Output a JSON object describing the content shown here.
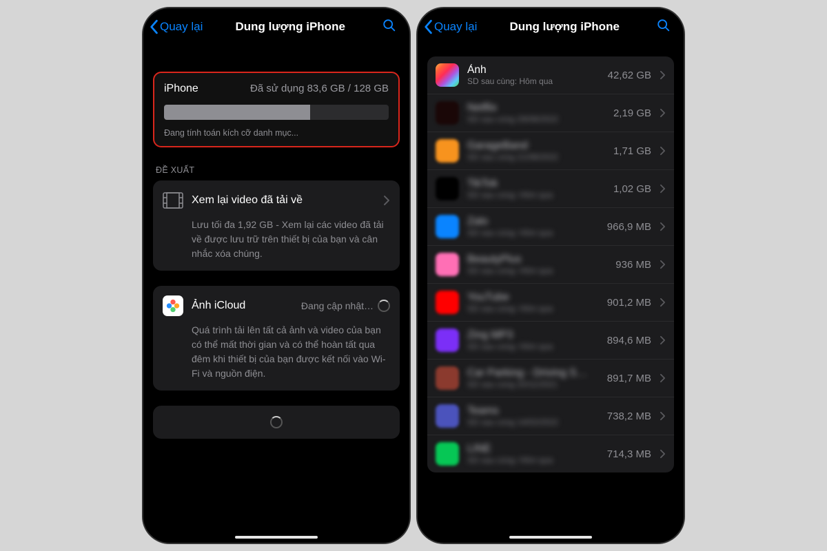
{
  "left": {
    "back_label": "Quay lại",
    "title": "Dung lượng iPhone",
    "storage": {
      "device": "iPhone",
      "used_text": "Đã sử dụng 83,6 GB / 128 GB",
      "bar_percent": 65,
      "calc_text": "Đang tính toán kích cỡ danh mục..."
    },
    "section_label": "ĐỀ XUẤT",
    "video_card": {
      "title": "Xem lại video đã tải về",
      "body": "Lưu tối đa 1,92 GB - Xem lại các video đã tải về được lưu trữ trên thiết bị của bạn và cân nhắc xóa chúng."
    },
    "icloud_card": {
      "title": "Ảnh iCloud",
      "status": "Đang cập nhật…",
      "body": "Quá trình tải lên tất cả ảnh và video của bạn có thể mất thời gian và có thể hoàn tất qua đêm khi thiết bị của bạn được kết nối vào Wi-Fi và nguồn điện."
    }
  },
  "right": {
    "back_label": "Quay lại",
    "title": "Dung lượng iPhone",
    "apps": [
      {
        "name": "Ảnh",
        "sub": "SD sau cùng: Hôm qua",
        "size": "42,62 GB",
        "clear": true,
        "color": "linear-gradient(135deg,#ffb347,#ff5e3a,#ff2d55,#af52de,#5ac8fa,#4cd964)"
      },
      {
        "name": "Netflix",
        "sub": "SD sau cùng 29/08/2022",
        "size": "2,19 GB",
        "clear": false,
        "color": "#1a0707"
      },
      {
        "name": "GarageBand",
        "sub": "SD sau cùng 21/08/2022",
        "size": "1,71 GB",
        "clear": false,
        "color": "#f7931e"
      },
      {
        "name": "TikTok",
        "sub": "SD sau cùng: Hôm qua",
        "size": "1,02 GB",
        "clear": false,
        "color": "#000"
      },
      {
        "name": "Zalo",
        "sub": "SD sau cùng: Hôm qua",
        "size": "966,9 MB",
        "clear": false,
        "color": "#0a84ff"
      },
      {
        "name": "BeautyPlus",
        "sub": "SD sau cùng: Hôm qua",
        "size": "936 MB",
        "clear": false,
        "color": "#ff6fb5"
      },
      {
        "name": "YouTube",
        "sub": "SD sau cùng: Hôm qua",
        "size": "901,2 MB",
        "clear": false,
        "color": "#ff0000"
      },
      {
        "name": "Zing MP3",
        "sub": "SD sau cùng: Hôm qua",
        "size": "894,6 MB",
        "clear": false,
        "color": "#7b2ff7"
      },
      {
        "name": "Car Parking - Driving S…",
        "sub": "SD sau cùng 20/11/2021",
        "size": "891,7 MB",
        "clear": false,
        "color": "#8b3a2e"
      },
      {
        "name": "Teams",
        "sub": "SD sau cùng 14/02/2022",
        "size": "738,2 MB",
        "clear": false,
        "color": "#4b53bc"
      },
      {
        "name": "LINE",
        "sub": "SD sau cùng: Hôm qua",
        "size": "714,3 MB",
        "clear": false,
        "color": "#06c755"
      }
    ]
  }
}
